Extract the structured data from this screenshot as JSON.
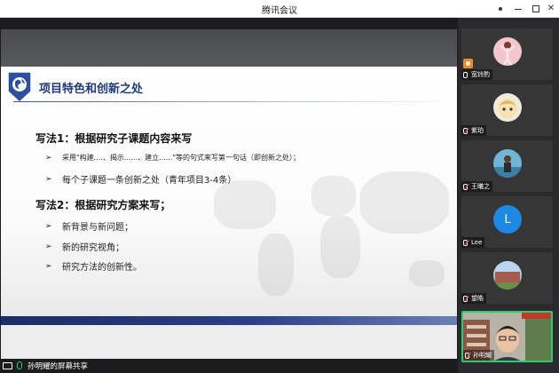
{
  "window": {
    "title": "腾讯会议"
  },
  "slide": {
    "header_title": "项目特色和创新之处",
    "method1_heading": "写法1：根据研究子课题内容来写",
    "method1_bullets": [
      "采用\"构建....、揭示......、建立......\"等的句式来写第一句话（即创新之处）；",
      "每个子课题一条创新之处（青年项目3-4条）"
    ],
    "method2_heading": "写法2：根据研究方案来写；",
    "method2_bullets": [
      "新背景与新问题；",
      "新的研究视角；",
      "研究方法的创新性。"
    ],
    "accent_color": "#1e3a78"
  },
  "status": {
    "sharing_text": "孙明耀的屏幕共享"
  },
  "participants": [
    {
      "name": "宽铃酌",
      "mic": "mic-icon",
      "host": true
    },
    {
      "name": "紫珀",
      "mic": "mic-muted-icon"
    },
    {
      "name": "王曦之",
      "mic": "mic-muted-icon"
    },
    {
      "name": "Lee",
      "mic": "mic-muted-icon",
      "avatar_letter": "L",
      "avatar_color": "#1e88e5"
    },
    {
      "name": "望皓",
      "mic": "mic-muted-icon"
    },
    {
      "name": "孙明耀",
      "mic": "mic-muted-icon",
      "speaking": true
    }
  ]
}
